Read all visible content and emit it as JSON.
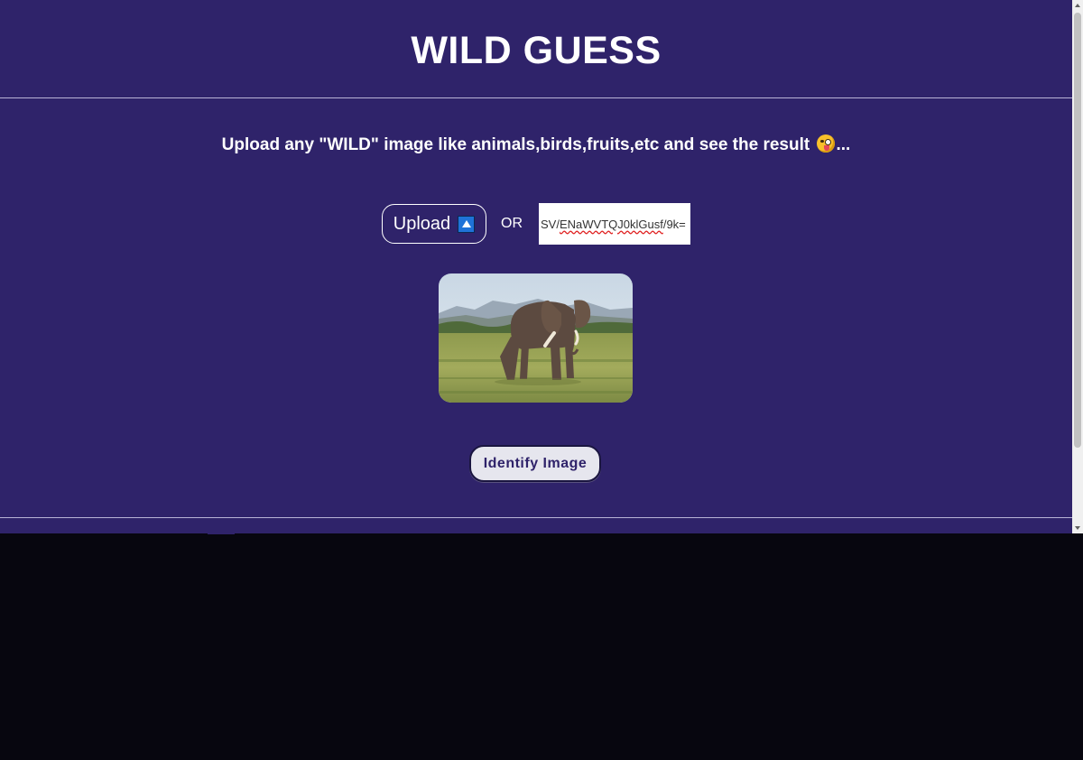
{
  "header": {
    "title": "WILD GUESS"
  },
  "main": {
    "tagline": "Upload any \"WILD\" image like animals,birds,fruits,etc and see the result",
    "tagline_suffix": "...",
    "tagline_emoji": "zany-face-emoji",
    "upload_label": "Upload",
    "upload_icon": "up-arrow-icon",
    "or_label": "OR",
    "url_value_prefix": "SV/",
    "url_value_misspelled": "ENaWVTQJ0klGusf",
    "url_value_rest": "/9k=",
    "preview_alt": "elephant-photo",
    "identify_label": "Identify Image"
  },
  "colors": {
    "background": "#2f236a",
    "text": "#ffffff",
    "button_bg": "#e6e6ee",
    "accent_icon": "#1f73d8"
  }
}
